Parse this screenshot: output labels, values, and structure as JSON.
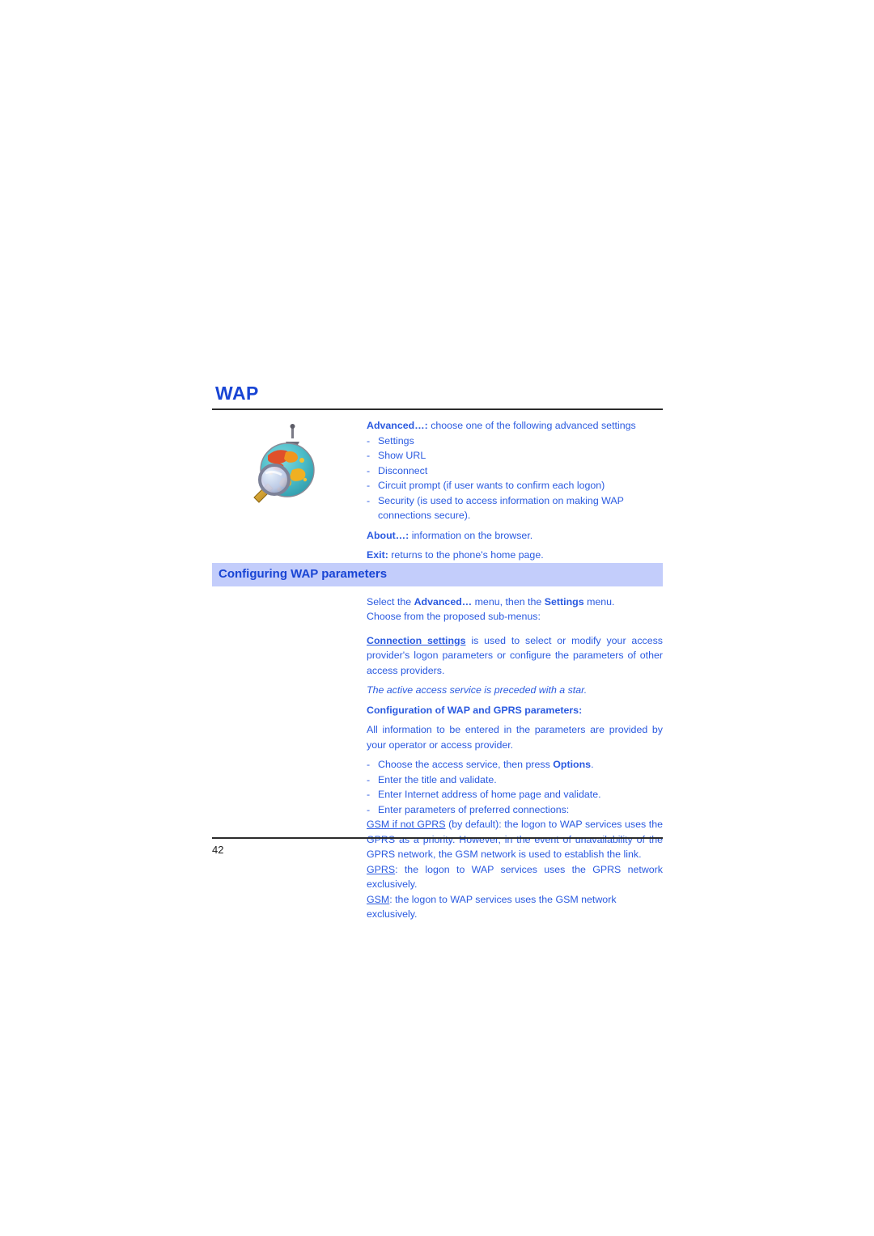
{
  "document": {
    "chapter_title": "WAP",
    "page_number": "42"
  },
  "colors": {
    "heading_blue": "#1945d4",
    "body_blue": "#2a5ae0",
    "banner_background": "#c3cdfb",
    "rule": "#2b2b2b",
    "page_number": "#1c1c1c"
  },
  "intro": {
    "icon_name": "globe-with-magnifier-icon",
    "advanced": {
      "term": "Advanced…:",
      "rest": " choose one of the following advanced settings"
    },
    "dash": "-",
    "options": [
      "Settings",
      "Show URL",
      "Disconnect",
      "Circuit prompt (if user wants to confirm each logon)",
      "Security (is used to access information on making WAP connections secure)."
    ],
    "about": {
      "term": "About…:",
      "rest": " information on the browser."
    },
    "exit": {
      "term": "Exit:",
      "rest": " returns to the phone's home page."
    }
  },
  "section": {
    "banner_title": "Configuring WAP parameters",
    "select_line_1_pre": "Select the ",
    "select_line_1_b1": "Advanced…",
    "select_line_1_mid": " menu, then the ",
    "select_line_1_b2": "Settings",
    "select_line_1_post": " menu.",
    "select_line_2": "Choose from the proposed sub-menus:",
    "connection": {
      "term": "Connection settings",
      "rest": " is used to select or modify your access provider's logon parameters or configure the parameters of other access providers."
    },
    "italic_note": "The active access service is preceded with a star.",
    "config_heading": "Configuration of WAP and GPRS parameters:",
    "config_intro": "All information to be entered in the parameters are provided by your operator or access provider.",
    "dash": "-",
    "steps": [
      {
        "pre": "Choose the access service, then press ",
        "bold": "Options",
        "post": "."
      },
      {
        "pre": "Enter the title and validate.",
        "bold": "",
        "post": ""
      },
      {
        "pre": "Enter Internet address of home page and validate.",
        "bold": "",
        "post": ""
      },
      {
        "pre": "Enter parameters of preferred connections:",
        "bold": "",
        "post": ""
      }
    ],
    "connection_types": [
      {
        "term": "GSM if not GPRS",
        "rest": " (by default): the logon to WAP services uses the GPRS as a priority. However, in the event of unavailability of the GPRS network, the GSM network is used to establish the link."
      },
      {
        "term": "GPRS",
        "rest": ": the logon to WAP services uses the GPRS network exclusively."
      },
      {
        "term": "GSM",
        "rest": ": the logon to WAP services uses the GSM network exclusively."
      }
    ]
  }
}
